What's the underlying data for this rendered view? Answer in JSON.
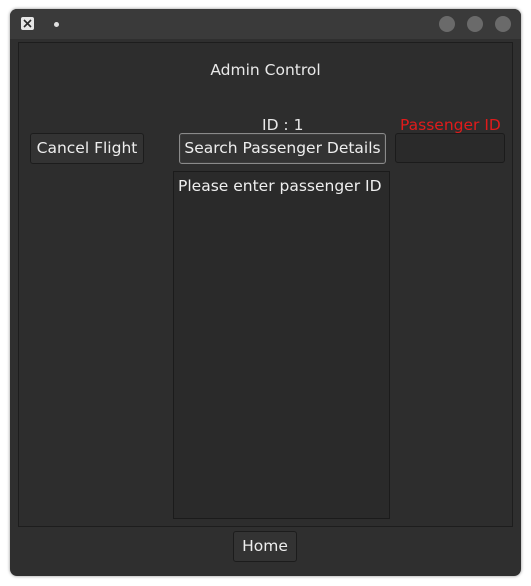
{
  "titlebar": {
    "app_icon": "x-window-icon",
    "window_buttons": [
      "minimize",
      "maximize",
      "close"
    ]
  },
  "header": {
    "title": "Admin Control"
  },
  "id_label": "ID : 1",
  "passenger_id": {
    "label": "Passenger ID",
    "label_color": "#e01b1b",
    "value": ""
  },
  "buttons": {
    "cancel_flight": "Cancel Flight",
    "search": "Search Passenger Details",
    "home": "Home"
  },
  "details": {
    "text": "Please enter passenger ID"
  }
}
